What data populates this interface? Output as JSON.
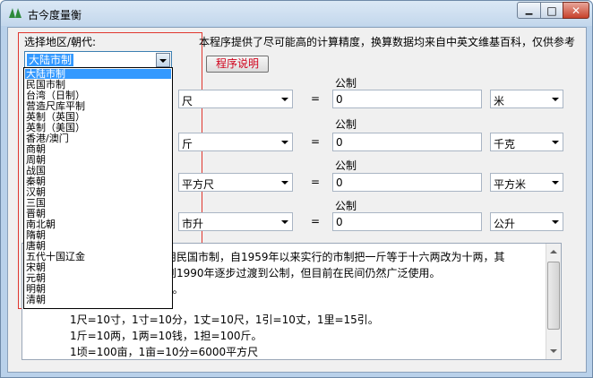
{
  "window": {
    "title": "古今度量衡",
    "minimize_glyph": "▁",
    "maximize_glyph": "□",
    "close_glyph": "✕"
  },
  "region": {
    "label": "选择地区/朝代:",
    "selected": "大陆市制",
    "options": [
      "大陆市制",
      "民国市制",
      "台湾（日制）",
      "营造尺库平制",
      "英制（英国）",
      "英制（美国）",
      "香港/澳门",
      "商朝",
      "周朝",
      "战国",
      "秦朝",
      "汉朝",
      "三国",
      "晋朝",
      "南北朝",
      "隋朝",
      "唐朝",
      "五代十国辽金",
      "宋朝",
      "元朝",
      "明朝",
      "清朝"
    ]
  },
  "notice": "本程序提供了尽可能高的计算精度，换算数据均来自中英文维基百科，仅供参考",
  "help_button": "程序说明",
  "conversions": [
    {
      "metric_label": "公制",
      "unit": "尺",
      "equals": "=",
      "value": "0",
      "metric_unit": "米"
    },
    {
      "metric_label": "公制",
      "unit": "斤",
      "equals": "=",
      "value": "0",
      "metric_unit": "千克"
    },
    {
      "metric_label": "公制",
      "unit": "平方尺",
      "equals": "=",
      "value": "0",
      "metric_unit": "平方米"
    },
    {
      "metric_label": "公制",
      "unit": "市升",
      "equals": "=",
      "value": "0",
      "metric_unit": "公升"
    }
  ],
  "description": {
    "lines": [
      "沿用民国市制，自1959年以来实行的市制把一斤等于十六两改为十两，其",
      "实到1990年逐步过渡到公制，但目前在民间仍然广泛使用。",
      "2斤。",
      "1尺=10寸，1寸=10分，1丈=10尺，1引=10丈，1里=15引。",
      "1斤=10两，1两=10钱，1担=100斤。",
      "1顷=100亩，1亩=10分=6000平方尺"
    ]
  },
  "colors": {
    "selection": "#3399ff",
    "help_text": "#d0021b",
    "frame": "#e0362e"
  }
}
